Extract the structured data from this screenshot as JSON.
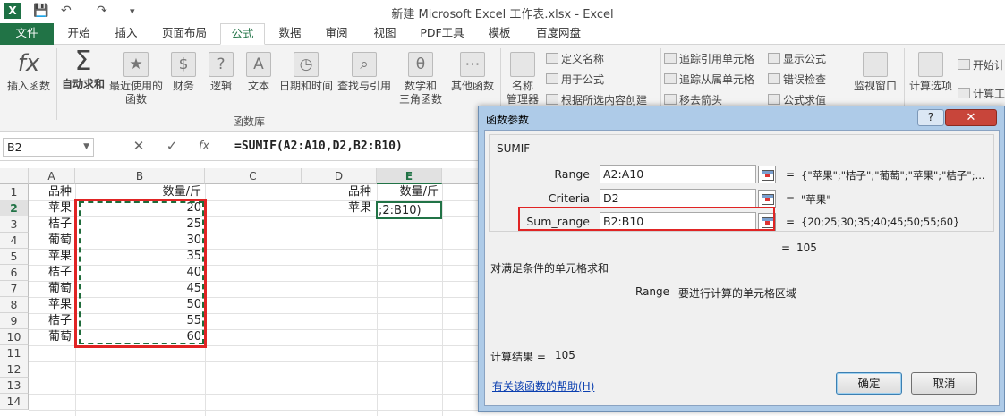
{
  "window": {
    "title": "新建 Microsoft Excel 工作表.xlsx - Excel",
    "app_icon": "X"
  },
  "quick_access": {
    "save": "💾",
    "undo": "↶",
    "redo": "↷",
    "more": "▾"
  },
  "tabs": [
    {
      "label": "文件"
    },
    {
      "label": "开始"
    },
    {
      "label": "插入"
    },
    {
      "label": "页面布局"
    },
    {
      "label": "公式",
      "active": true
    },
    {
      "label": "数据"
    },
    {
      "label": "审阅"
    },
    {
      "label": "视图"
    },
    {
      "label": "PDF工具"
    },
    {
      "label": "模板"
    },
    {
      "label": "百度网盘"
    }
  ],
  "ribbon": {
    "insert_function": "插入函数",
    "autosum": "自动求和",
    "recent_1": "最近使用的",
    "recent_2": "函数",
    "financial": "财务",
    "logical": "逻辑",
    "text": "文本",
    "datetime": "日期和时间",
    "lookup": "查找与引用",
    "math_1": "数学和",
    "math_2": "三角函数",
    "more": "其他函数",
    "name_mgr_1": "名称",
    "name_mgr_2": "管理器",
    "define_name": "定义名称",
    "use_in_formula": "用于公式",
    "create_from_sel": "根据所选内容创建",
    "trace_precedents": "追踪引用单元格",
    "trace_dependents": "追踪从属单元格",
    "remove_arrows": "移去箭头",
    "show_formulas": "显示公式",
    "error_check": "错误检查",
    "evaluate": "公式求值",
    "watch_window": "监视窗口",
    "calc_options": "计算选项",
    "calc_now": "开始计",
    "calc_sheet": "计算工",
    "group_label": "函数库",
    "icons": {
      "fx": "fx",
      "sigma": "Σ",
      "star": "★",
      "coins": "$",
      "question": "?",
      "textA": "A",
      "clock": "◷",
      "search": "⌕",
      "theta": "θ",
      "dots": "⋯"
    }
  },
  "formula_bar": {
    "name_box": "B2",
    "cancel": "✕",
    "enter": "✓",
    "fx": "fx",
    "formula": "=SUMIF(A2:A10,D2,B2:B10)"
  },
  "sheet": {
    "columns": [
      "A",
      "B",
      "C",
      "D",
      "E"
    ],
    "rows": [
      "1",
      "2",
      "3",
      "4",
      "5",
      "6",
      "7",
      "8",
      "9",
      "10",
      "11",
      "12",
      "13",
      "14"
    ],
    "a_values": [
      "品种",
      "苹果",
      "桔子",
      "葡萄",
      "苹果",
      "桔子",
      "葡萄",
      "苹果",
      "桔子",
      "葡萄"
    ],
    "b_values": [
      "数量/斤",
      "20",
      "25",
      "30",
      "35",
      "40",
      "45",
      "50",
      "55",
      "60"
    ],
    "d1": "品种",
    "e1": "数量/斤",
    "d2": "苹果",
    "e2_edit": ";2:B10)"
  },
  "dialog": {
    "title": "函数参数",
    "help_btn": "?",
    "close_btn": "✕",
    "function_name": "SUMIF",
    "args": [
      {
        "label": "Range",
        "value": "A2:A10",
        "eq": "=",
        "result": "{\"苹果\";\"桔子\";\"葡萄\";\"苹果\";\"桔子\";..."
      },
      {
        "label": "Criteria",
        "value": "D2",
        "eq": "=",
        "result": "\"苹果\""
      },
      {
        "label": "Sum_range",
        "value": "B2:B10",
        "eq": "=",
        "result": "{20;25;30;35;40;45;50;55;60}"
      }
    ],
    "overall_eq": "=",
    "overall_result": "105",
    "description": "对满足条件的单元格求和",
    "arg_help_name": "Range",
    "arg_help_text": "要进行计算的单元格区域",
    "calc_result_label": "计算结果 =",
    "calc_result_value": "105",
    "help_link": "有关该函数的帮助(H)",
    "ok": "确定",
    "cancel": "取消"
  }
}
